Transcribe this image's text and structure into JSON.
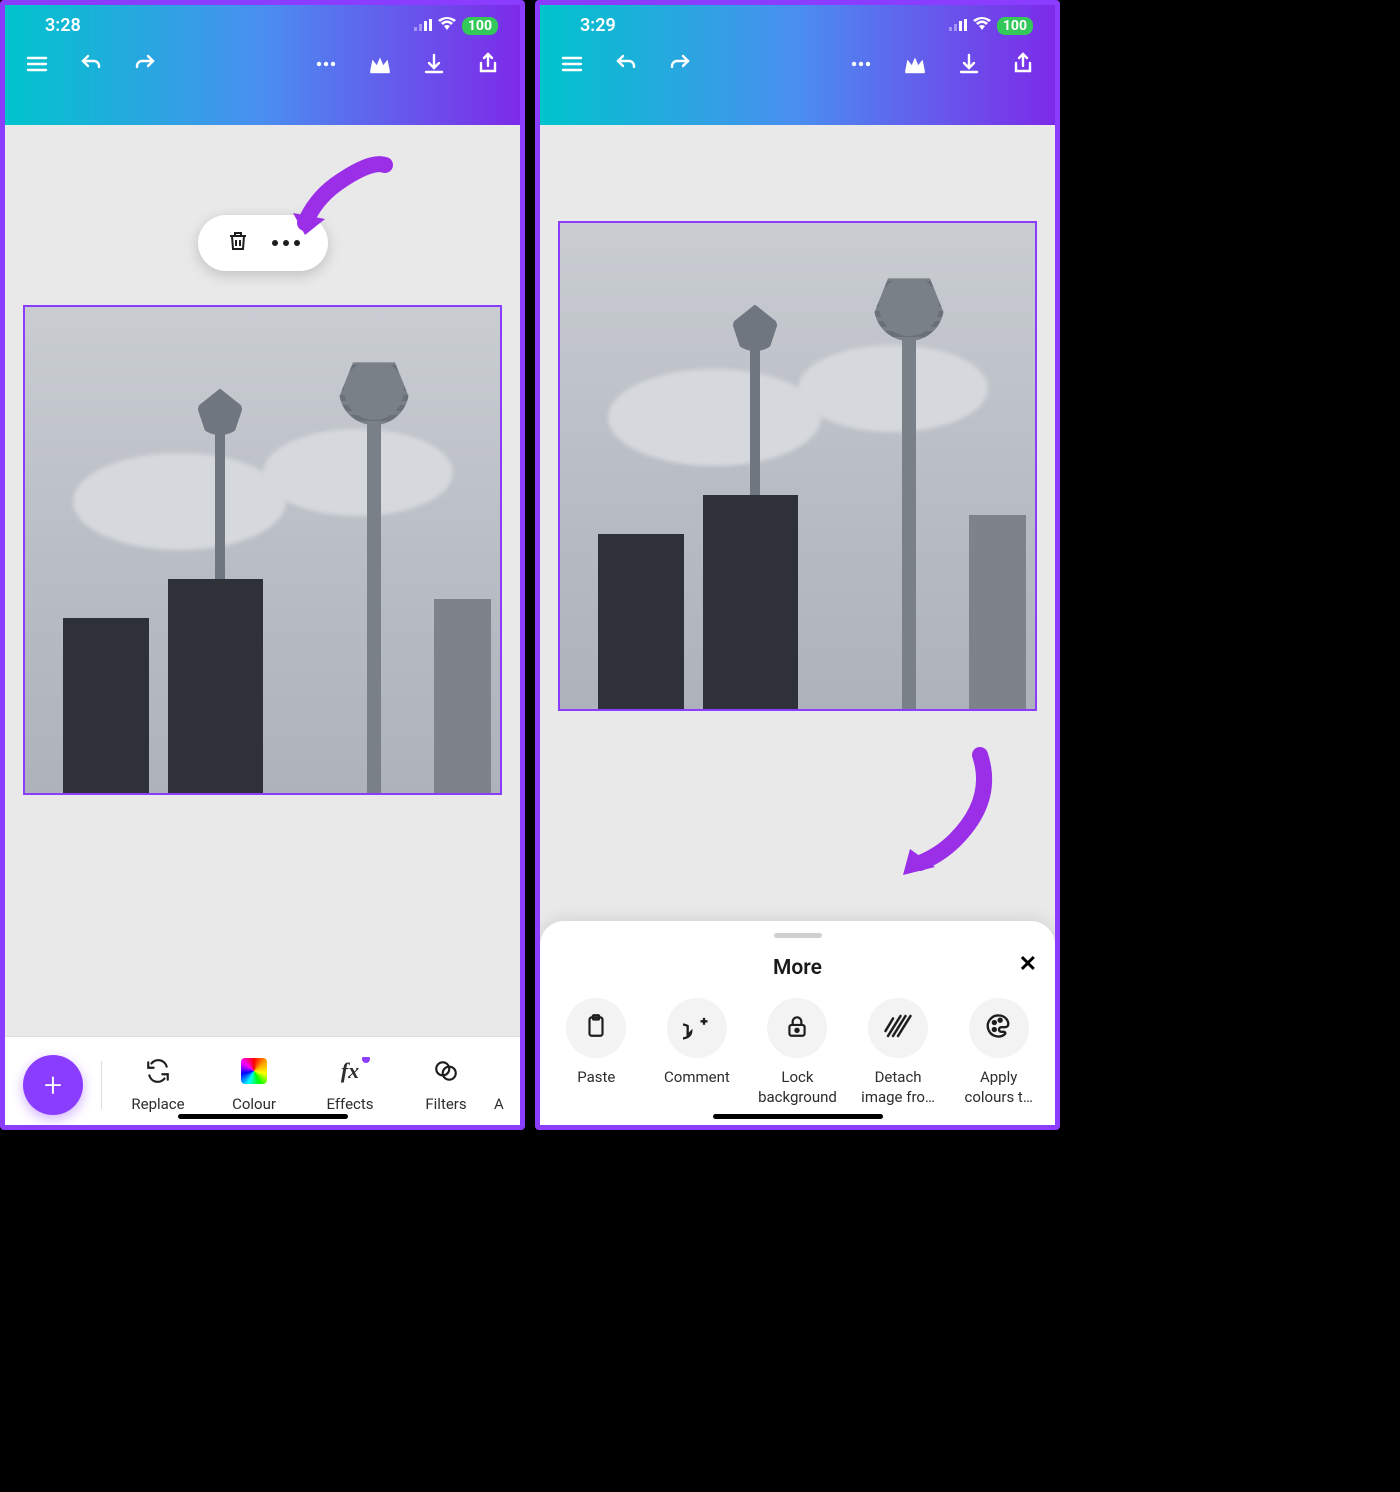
{
  "left": {
    "status": {
      "time": "3:28",
      "battery": "100"
    },
    "toolbar": [
      {
        "name": "replace",
        "label": "Replace"
      },
      {
        "name": "colour",
        "label": "Colour"
      },
      {
        "name": "effects",
        "label": "Effects"
      },
      {
        "name": "filters",
        "label": "Filters"
      },
      {
        "name": "adjust-partial",
        "label": "A"
      }
    ]
  },
  "right": {
    "status": {
      "time": "3:29",
      "battery": "100"
    },
    "sheet": {
      "title": "More",
      "items": [
        {
          "name": "paste",
          "label": "Paste"
        },
        {
          "name": "comment",
          "label": "Comment"
        },
        {
          "name": "lock-background",
          "label": "Lock\nbackground"
        },
        {
          "name": "detach-image",
          "label": "Detach\nimage fro…"
        },
        {
          "name": "apply-colours",
          "label": "Apply\ncolours t…"
        }
      ]
    }
  }
}
